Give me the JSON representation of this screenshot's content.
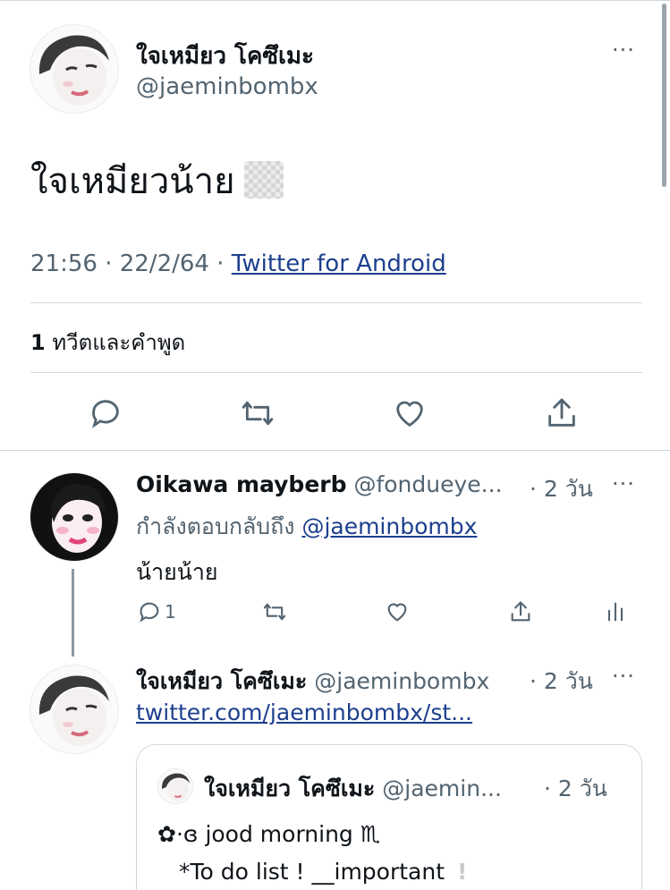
{
  "main_tweet": {
    "author_name": "ใจเหมียว โคซึเมะ",
    "author_handle": "@jaeminbombx",
    "text": "ใจเหมียวน้าย",
    "timestamp": "21:56 · 22/2/64 · ",
    "source": "Twitter for Android",
    "stats_count": "1",
    "stats_label": " ทวีตและคำพูด",
    "more": "···"
  },
  "reply": {
    "author_name": "Oikawa mayberb",
    "author_handle": " @fondueye...",
    "time": "· 2 วัน",
    "replying_prefix": "กำลังตอบกลับถึง ",
    "replying_to": "@jaeminbombx",
    "text": "น้ายน้าย",
    "reply_count": "1",
    "more": "···"
  },
  "self_reply": {
    "author_name": "ใจเหมียว โคซึเมะ",
    "author_handle": " @jaeminbombx",
    "time": "· 2 วัน",
    "link": "twitter.com/jaeminbombx/st...",
    "more": "···"
  },
  "quoted": {
    "author_name": "ใจเหมียว โคซึเมะ",
    "author_handle": " @jaemin...",
    "time": "· 2 วัน",
    "line1": "✿·ɞ jood morning ♏",
    "line2": "*To do list ! __important",
    "line2_mark": "!"
  }
}
